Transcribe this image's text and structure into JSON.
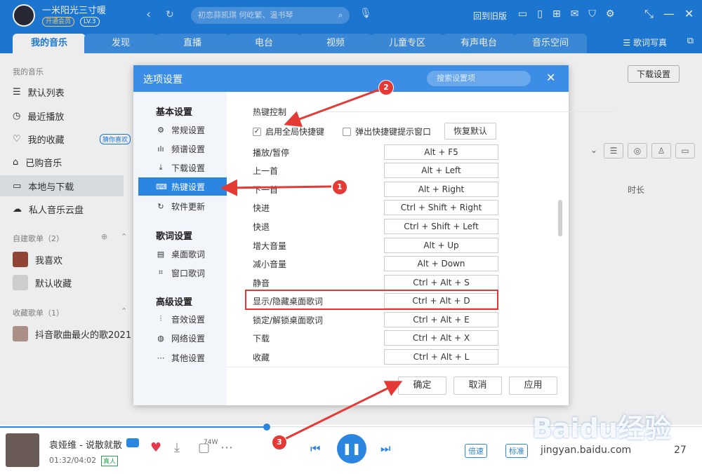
{
  "top": {
    "username": "一米阳光三寸暖",
    "vip": "开通会员",
    "level": "LV.3",
    "search_placeholder": "初恋蒜凯琪 何屹繁、温书琴",
    "old_version": "回到旧版"
  },
  "tabs": [
    "我的音乐",
    "发现",
    "直播",
    "电台",
    "视频",
    "儿童专区",
    "有声电台",
    "音乐空间"
  ],
  "tabbar": {
    "lyric": "歌词写真"
  },
  "sidebar": {
    "my_music_head": "我的音乐",
    "items": [
      "默认列表",
      "最近播放",
      "我的收藏",
      "已购音乐",
      "本地与下载",
      "私人音乐云盘"
    ],
    "fav_tag": "猜你喜欢",
    "created_head": "自建歌单（2）",
    "created": [
      "我喜欢",
      "默认收藏"
    ],
    "collected_head": "收藏歌单（1）",
    "collected": [
      "抖音歌曲最火的歌2021"
    ]
  },
  "content": {
    "download_settings": "下载设置",
    "time_col": "时长"
  },
  "dialog": {
    "title": "选项设置",
    "search_placeholder": "搜索设置项",
    "groups": [
      {
        "name": "基本设置",
        "items": [
          "常规设置",
          "频谱设置",
          "下载设置",
          "热键设置",
          "软件更新"
        ]
      },
      {
        "name": "歌词设置",
        "items": [
          "桌面歌词",
          "窗口歌词"
        ]
      },
      {
        "name": "高级设置",
        "items": [
          "音效设置",
          "网络设置",
          "其他设置"
        ]
      }
    ],
    "section": "热键控制",
    "enable_global": "启用全局快捷键",
    "popup_hint": "弹出快捷键提示窗口",
    "reset": "恢复默认",
    "hotkeys": [
      {
        "label": "播放/暂停",
        "key": "Alt + F5"
      },
      {
        "label": "上一首",
        "key": "Alt + Left"
      },
      {
        "label": "下一首",
        "key": "Alt + Right"
      },
      {
        "label": "快进",
        "key": "Ctrl + Shift + Right"
      },
      {
        "label": "快退",
        "key": "Ctrl + Shift + Left"
      },
      {
        "label": "增大音量",
        "key": "Alt + Up"
      },
      {
        "label": "减小音量",
        "key": "Alt + Down"
      },
      {
        "label": "静音",
        "key": "Ctrl + Alt + S"
      },
      {
        "label": "显示/隐藏桌面歌词",
        "key": "Ctrl + Alt + D"
      },
      {
        "label": "锁定/解锁桌面歌词",
        "key": "Ctrl + Alt + E"
      },
      {
        "label": "下载",
        "key": "Ctrl + Alt + X"
      },
      {
        "label": "收藏",
        "key": "Ctrl + Alt + L"
      }
    ],
    "ok": "确定",
    "cancel": "取消",
    "apply": "应用"
  },
  "player": {
    "song": "袁娅维 - 说散就散",
    "time": "01:32/04:02",
    "real": "真人",
    "comments": "74W",
    "speed": "倍速",
    "quality": "标准",
    "count": "27",
    "progress": 0.38
  },
  "annotations": [
    "1",
    "2",
    "3"
  ],
  "watermark": {
    "brand": "Baidu经验",
    "url": "jingyan.baidu.com"
  },
  "colors": {
    "accent": "#1f7fe0",
    "annotation": "#e53935"
  }
}
